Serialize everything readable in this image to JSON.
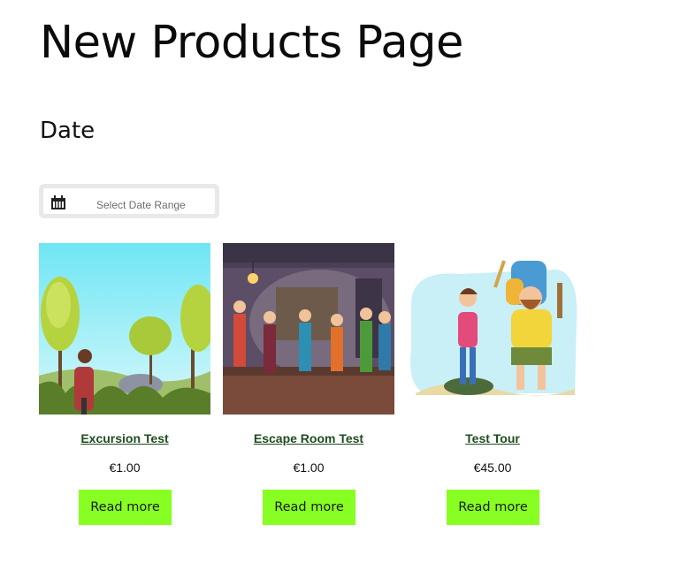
{
  "page": {
    "title": "New Products Page"
  },
  "filters": {
    "section_title": "Date",
    "date_range": {
      "placeholder": "Select Date Range",
      "icon": "calendar-icon"
    }
  },
  "products": [
    {
      "name": "Excursion Test",
      "price": "€1.00",
      "button": "Read more",
      "image": "hiker-in-forest-illustration"
    },
    {
      "name": "Escape Room Test",
      "price": "€1.00",
      "button": "Read more",
      "image": "escape-room-group-illustration"
    },
    {
      "name": "Test Tour",
      "price": "€45.00",
      "button": "Read more",
      "image": "backpacker-couple-illustration"
    }
  ],
  "colors": {
    "accent_button": "#88ff22",
    "link": "#1f4d1f"
  }
}
